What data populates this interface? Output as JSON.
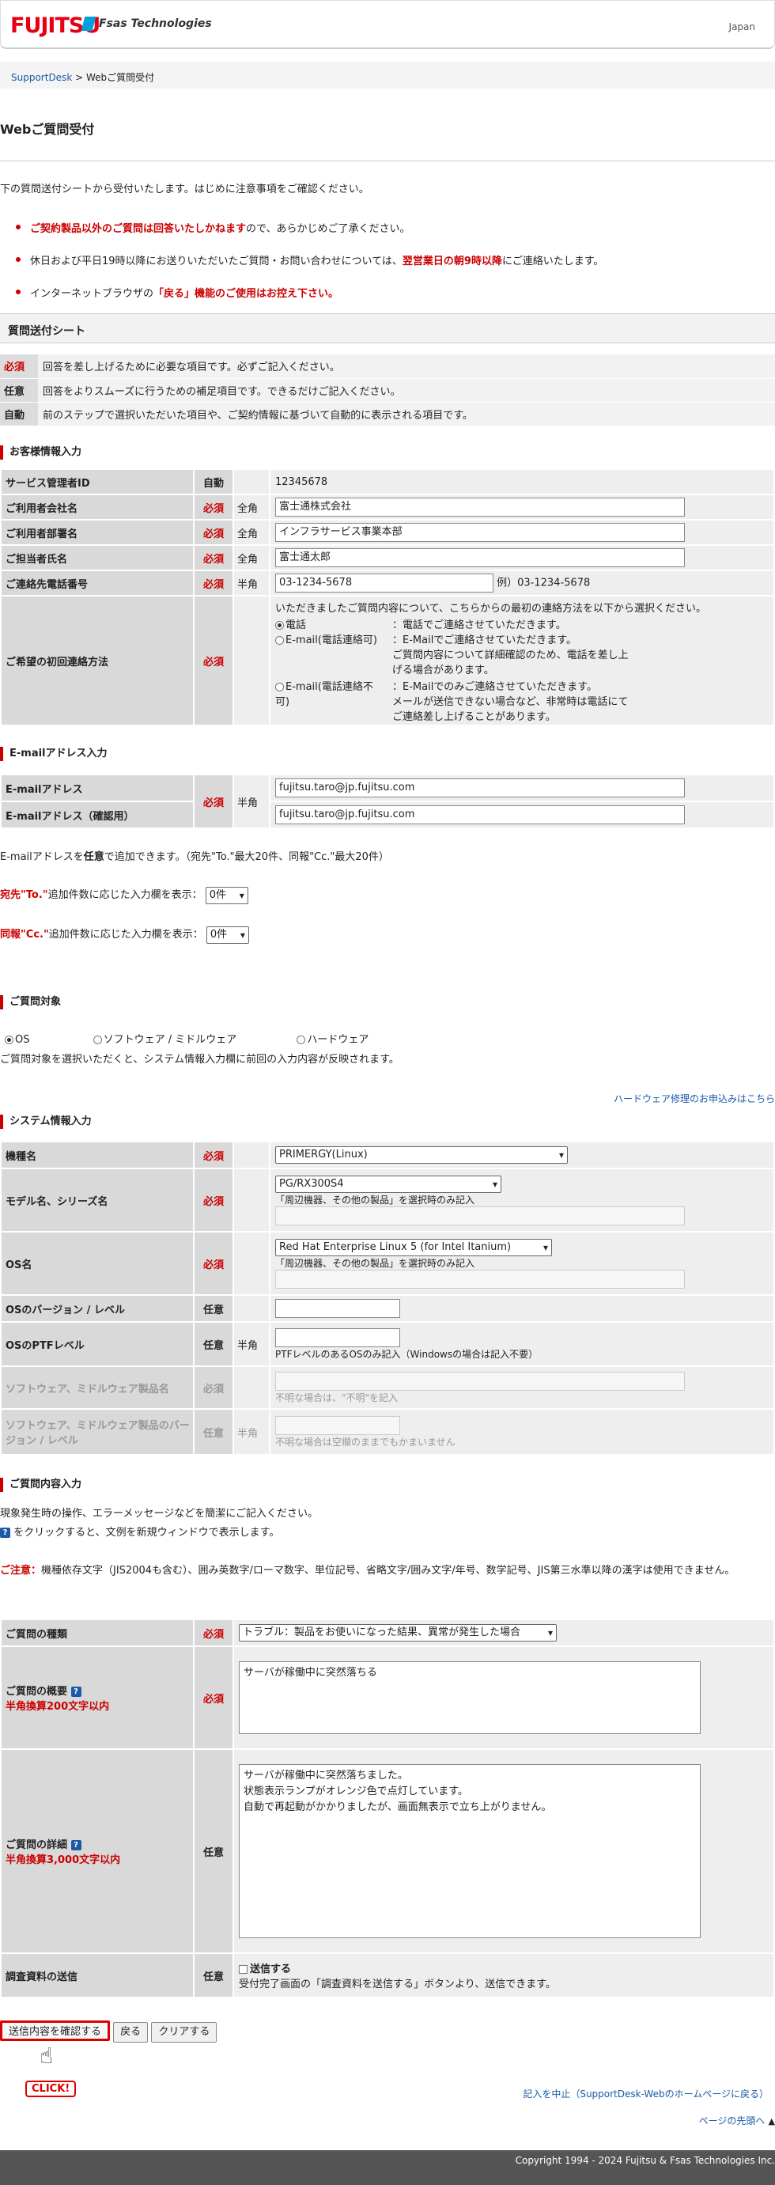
{
  "header": {
    "brand": "FUJITSU",
    "partner": "Fsas Technologies",
    "region": "Japan"
  },
  "breadcrumb": {
    "home": "SupportDesk",
    "sep": ">",
    "current": "Webご質問受付"
  },
  "page_title": "Webご質問受付",
  "intro": "下の質問送付シートから受付いたします。はじめに注意事項をご確認ください。",
  "notes": [
    {
      "hl": "ご契約製品以外のご質問は回答いたしかねます",
      "rest": "ので、あらかじめご了承ください。"
    },
    {
      "pre": "休日および平日19時以降にお送りいただいたご質問・お問い合わせについては、",
      "hl": "翌営業日の朝9時以降",
      "rest": "にご連絡いたします。"
    },
    {
      "pre": "インターネットブラウザの",
      "hl": "「戻る」機能のご使用はお控え下さい。"
    }
  ],
  "sheet_title": "質問送付シート",
  "legend": [
    {
      "k": "必須",
      "v": "回答を差し上げるために必要な項目です。必ずご記入ください。"
    },
    {
      "k": "任意",
      "v": "回答をよりスムーズに行うための補足項目です。できるだけご記入ください。"
    },
    {
      "k": "自動",
      "v": "前のステップで選択いただいた項目や、ご契約情報に基づいて自動的に表示される項目です。"
    }
  ],
  "tags": {
    "req": "必須",
    "opt": "任意",
    "auto": "自動",
    "zen": "全角",
    "han": "半角"
  },
  "customer": {
    "title": "お客様情報入力",
    "admin_id_label": "サービス管理者ID",
    "admin_id": "12345678",
    "company_label": "ご利用者会社名",
    "company": "富士通株式会社",
    "dept_label": "ご利用者部署名",
    "dept": "インフラサービス事業本部",
    "person_label": "ご担当者氏名",
    "person": "富士通太郎",
    "phone_label": "ご連絡先電話番号",
    "phone": "03-1234-5678",
    "phone_example": "例）03-1234-5678",
    "contact_label": "ご希望の初回連絡方法",
    "contact_intro": "いただきましたご質問内容について、こちらからの最初の連絡方法を以下から選択ください。",
    "contact_opts": [
      {
        "name": "電話",
        "desc": "：電話でご連絡させていただきます。"
      },
      {
        "name": "E-mail(電話連絡可)",
        "desc": "：E-Mailでご連絡させていただきます。\nご質問内容について詳細確認のため、電話を差し上げる場合があります。"
      },
      {
        "name": "E-mail(電話連絡不可)",
        "desc": "：E-Mailでのみご連絡させていただきます。\nメールが送信できない場合など、非常時は電話にてご連絡差し上げることがあります。"
      }
    ]
  },
  "email": {
    "title": "E-mailアドレス入力",
    "label1": "E-mailアドレス",
    "label2": "E-mailアドレス（確認用）",
    "value1": "fujitsu.taro@jp.fujitsu.com",
    "value2": "fujitsu.taro@jp.fujitsu.com",
    "note_pre": "E-mailアドレスを",
    "note_hl": "任意",
    "note_post": "で追加できます。（宛先\"To.\"最大20件、同報\"Cc.\"最大20件）",
    "to_hl": "宛先\"To.\"",
    "to_rest": "追加件数に応じた入力欄を表示：",
    "to_val": "0件",
    "cc_hl": "同報\"Cc.\"",
    "cc_rest": "追加件数に応じた入力欄を表示：",
    "cc_val": "0件"
  },
  "target": {
    "title": "ご質問対象",
    "options": [
      "OS",
      "ソフトウェア / ミドルウェア",
      "ハードウェア"
    ],
    "note": "ご質問対象を選択いただくと、システム情報入力欄に前回の入力内容が反映されます。",
    "hw_link": "ハードウェア修理のお申込みはこちら"
  },
  "system": {
    "title": "システム情報入力",
    "machine_label": "機種名",
    "machine": "PRIMERGY(Linux)",
    "model_label": "モデル名、シリーズ名",
    "model": "PG/RX300S4",
    "model_note": "「周辺機器、その他の製品」を選択時のみ記入",
    "os_label": "OS名",
    "os": "Red Hat Enterprise Linux 5 (for Intel Itanium)",
    "os_note": "「周辺機器、その他の製品」を選択時のみ記入",
    "osver_label": "OSのバージョン / レベル",
    "ptf_label": "OSのPTFレベル",
    "ptf_note": "PTFレベルのあるOSのみ記入（Windowsの場合は記入不要）",
    "sw_label": "ソフトウェア、ミドルウェア製品名",
    "sw_note": "不明な場合は、\"不明\"を記入",
    "swver_label": "ソフトウェア、ミドルウェア製品のバージョン / レベル",
    "swver_note": "不明な場合は空欄のままでもかまいません"
  },
  "question": {
    "title": "ご質問内容入力",
    "line1": "現象発生時の操作、エラーメッセージなどを簡潔にご記入ください。",
    "line2": "をクリックすると、文例を新規ウィンドウで表示します。",
    "caution_hl": "ご注意：",
    "caution": "機種依存文字（JIS2004も含む）、囲み英数字/ローマ数字、単位記号、省略文字/囲み文字/年号、数学記号、JIS第三水準以降の漢字は使用できません。",
    "type_label": "ご質問の種類",
    "type": "トラブル：製品をお使いになった結果、異常が発生した場合",
    "summary_label": "ご質問の概要",
    "summary_limit": "半角換算200文字以内",
    "summary": "サーバが稼働中に突然落ちる",
    "detail_label": "ご質問の詳細",
    "detail_limit": "半角換算3,000文字以内",
    "detail": "サーバが稼働中に突然落ちました。\n状態表示ランプがオレンジ色で点灯しています。\n自動で再起動がかかりましたが、画面無表示で立ち上がりません。",
    "attach_label": "調査資料の送信",
    "attach_cb": "送信する",
    "attach_note": "受付完了画面の「調査資料を送信する」ボタンより、送信できます。"
  },
  "buttons": {
    "confirm": "送信内容を確認する",
    "back": "戻る",
    "clear": "クリアする",
    "click": "CLICK!"
  },
  "links": {
    "cancel": "記入を中止（SupportDesk-Webのホームページに戻る）",
    "top": "ページの先頭へ"
  },
  "footer": "Copyright 1994 - 2024 Fujitsu & Fsas Technologies Inc.",
  "colors": {
    "accent": "#c00",
    "brand": "#e60012",
    "link": "#1a5aa6"
  }
}
